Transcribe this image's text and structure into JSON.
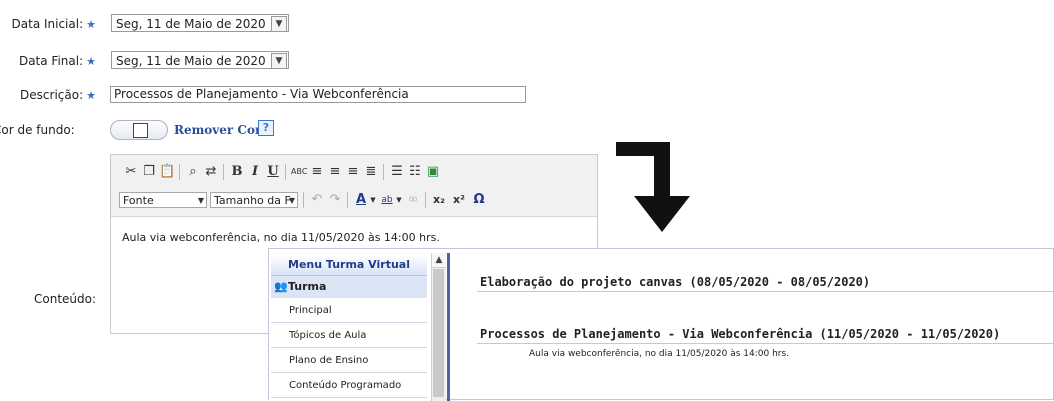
{
  "form": {
    "data_inicial_label": "Data Inicial:",
    "data_inicial_value": "Seg, 11 de Maio de 2020",
    "data_final_label": "Data Final:",
    "data_final_value": "Seg, 11 de Maio de 2020",
    "descricao_label": "Descrição:",
    "descricao_value": "Processos de Planejamento - Via Webconferência",
    "cor_label": "Cor de fundo:",
    "remover_cor": "Remover Cor",
    "help": "?",
    "conteudo_label": "Conteúdo:",
    "required_star": "★"
  },
  "editor": {
    "font_select": "Fonte",
    "size_select": "Tamanho da F",
    "content": "Aula via webconferência, no dia 11/05/2020 às 14:00 hrs.",
    "icons": [
      "cut-icon",
      "copy-icon",
      "paste-icon",
      "find-icon",
      "replace-icon",
      "bold-icon",
      "italic-icon",
      "underline-icon",
      "spellcheck-icon",
      "align-left-icon",
      "align-center-icon",
      "align-right-icon",
      "align-justify-icon",
      "bullet-list-icon",
      "numbered-list-icon",
      "image-icon",
      "undo-icon",
      "redo-icon",
      "text-color-icon",
      "highlight-icon",
      "link-icon",
      "subscript-icon",
      "superscript-icon",
      "omega-icon"
    ]
  },
  "menu": {
    "title": "Menu Turma Virtual",
    "section": "Turma",
    "items": [
      "Principal",
      "Tópicos de Aula",
      "Plano de Ensino",
      "Conteúdo Programado"
    ]
  },
  "topics": [
    {
      "title": "Elaboração do projeto canvas (08/05/2020 - 08/05/2020)"
    },
    {
      "title": "Processos de Planejamento - Via Webconferência (11/05/2020 - 11/05/2020)",
      "description": "Aula via webconferência, no dia 11/05/2020 às 14:00 hrs."
    }
  ],
  "colors": {
    "accent": "#2b4f98",
    "star": "#3a6fc2",
    "divider": "#4d63a8"
  }
}
